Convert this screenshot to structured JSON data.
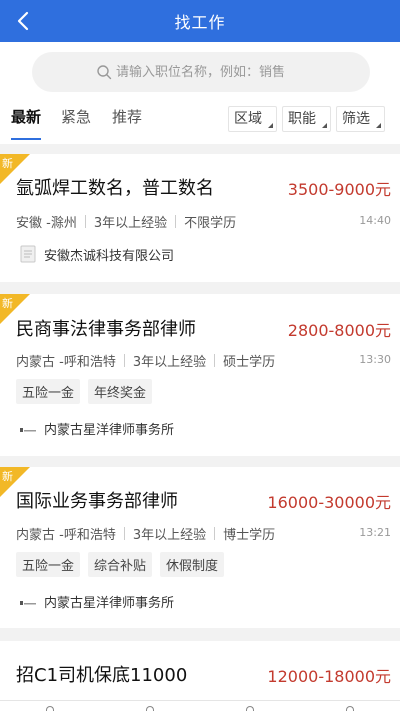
{
  "header": {
    "title": "找工作"
  },
  "search": {
    "placeholder": "请输入职位名称，例如：销售"
  },
  "tabs": [
    {
      "label": "最新"
    },
    {
      "label": "紧急"
    },
    {
      "label": "推荐"
    }
  ],
  "filters": [
    {
      "label": "区域"
    },
    {
      "label": "职能"
    },
    {
      "label": "筛选"
    }
  ],
  "jobs": [
    {
      "badge": "新",
      "title": "氩弧焊工数名，普工数名",
      "salary": "3500-9000元",
      "location": "安徽 -滁州",
      "experience": "3年以上经验",
      "education": "不限学历",
      "time": "14:40",
      "tags": [],
      "company": "安徽杰诚科技有限公司"
    },
    {
      "badge": "新",
      "title": "民商事法律事务部律师",
      "salary": "2800-8000元",
      "location": "内蒙古 -呼和浩特",
      "experience": "3年以上经验",
      "education": "硕士学历",
      "time": "13:30",
      "tags": [
        "五险一金",
        "年终奖金"
      ],
      "company": "内蒙古星洋律师事务所"
    },
    {
      "badge": "新",
      "title": "国际业务事务部律师",
      "salary": "16000-30000元",
      "location": "内蒙古 -呼和浩特",
      "experience": "3年以上经验",
      "education": "博士学历",
      "time": "13:21",
      "tags": [
        "五险一金",
        "综合补贴",
        "休假制度"
      ],
      "company": "内蒙古星洋律师事务所"
    },
    {
      "title": "招C1司机保底11000",
      "salary": "12000-18000元"
    }
  ],
  "colors": {
    "primary": "#2f6fde",
    "salary": "#c33a2e",
    "badge": "#f2b827"
  }
}
